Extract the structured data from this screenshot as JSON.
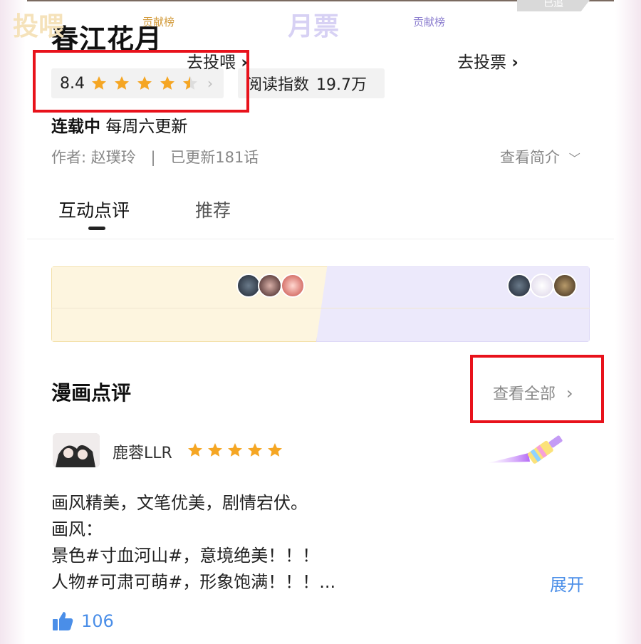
{
  "header": {
    "badge": "已追",
    "title": "春江花月",
    "rating": {
      "value": "8.4",
      "stars_filled": 4.5,
      "stars_total": 5
    },
    "read_index": {
      "label": "阅读指数",
      "value": "19.7万"
    },
    "status": {
      "state": "连载中",
      "schedule": "每周六更新"
    },
    "author": "作者: 赵璞玲",
    "meta_sep": "|",
    "updated": "已更新181话",
    "intro_label": "查看简介"
  },
  "tabs": [
    {
      "label": "互动点评",
      "active": true
    },
    {
      "label": "推荐",
      "active": false
    }
  ],
  "support": {
    "feed": {
      "title": "投喂",
      "rank_label": "贡献榜",
      "action": "去投喂"
    },
    "vote": {
      "title": "月票",
      "rank_label": "贡献榜",
      "action": "去投票"
    }
  },
  "reviews": {
    "section_title": "漫画点评",
    "view_all": "查看全部",
    "items": [
      {
        "user": "鹿蓉LLR",
        "stars": 5,
        "lines": [
          "画风精美，文笔优美，剧情宕伏。",
          "画风：",
          "景色#寸血河山#，意境绝美！！！",
          "人物#可肃可萌#，形象饱满！！！..."
        ],
        "expand": "展开",
        "likes": "106"
      }
    ]
  },
  "colors": {
    "star": "#f5a623",
    "accent_blue": "#4a8ee8",
    "annotation_red": "#e8121b",
    "feed_bg": "#fdf5df",
    "vote_bg": "#ece9fb"
  }
}
